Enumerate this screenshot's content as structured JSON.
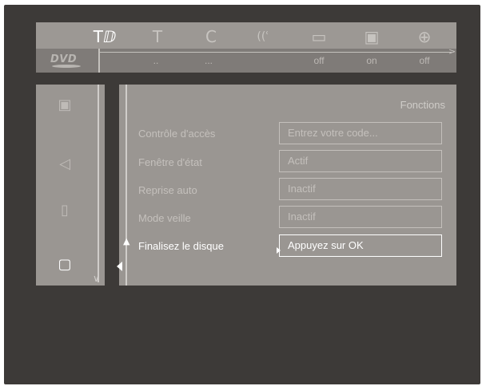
{
  "topbar": {
    "icons": [
      {
        "name": "tools-icon",
        "glyph": "Tⅅ",
        "active": true
      },
      {
        "name": "text-icon",
        "glyph": "T",
        "active": false
      },
      {
        "name": "color-icon",
        "glyph": "C",
        "active": false
      },
      {
        "name": "audio-icon",
        "glyph": "((ʿ",
        "active": false
      },
      {
        "name": "subtitle-icon",
        "glyph": "▭",
        "active": false
      },
      {
        "name": "camera-angle-icon",
        "glyph": "▣",
        "active": false
      },
      {
        "name": "zoom-icon",
        "glyph": "⊕",
        "active": false
      }
    ],
    "logo": "DVD",
    "values": [
      "..",
      "...",
      "off",
      "on",
      "off"
    ]
  },
  "sidebar": {
    "items": [
      {
        "name": "picture-icon",
        "glyph": "▣",
        "active": false
      },
      {
        "name": "sound-icon",
        "glyph": "◁",
        "active": false
      },
      {
        "name": "language-icon",
        "glyph": "▯",
        "active": false
      },
      {
        "name": "features-icon",
        "glyph": "▢",
        "active": true
      }
    ]
  },
  "panel": {
    "title": "Fonctions",
    "rows": [
      {
        "label": "Contrôle d'accès",
        "value": "Entrez votre code...",
        "active": false
      },
      {
        "label": "Fenêtre d'état",
        "value": "Actif",
        "active": false
      },
      {
        "label": "Reprise auto",
        "value": "Inactif",
        "active": false
      },
      {
        "label": "Mode veille",
        "value": "Inactif",
        "active": false
      },
      {
        "label": "Finalisez le disque",
        "value": "Appuyez sur OK",
        "active": true
      }
    ]
  }
}
